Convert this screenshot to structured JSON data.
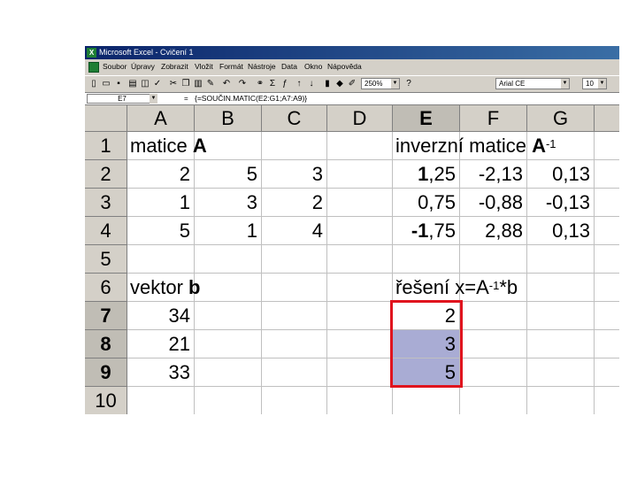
{
  "window": {
    "title": "Microsoft Excel - Cvičení 1"
  },
  "menu": [
    "Soubor",
    "Úpravy",
    "Zobrazit",
    "Vložit",
    "Formát",
    "Nástroje",
    "Data",
    "Okno",
    "Nápověda"
  ],
  "toolbar": {
    "zoom": "250%",
    "font": "Arial CE",
    "font_size": "10"
  },
  "formula_bar": {
    "name_box": "E7",
    "eq": "=",
    "formula": "{=SOUČIN.MATIC(E2:G1;A7:A9)}"
  },
  "columns": [
    "A",
    "B",
    "C",
    "D",
    "E",
    "F",
    "G"
  ],
  "rows": [
    "1",
    "2",
    "3",
    "4",
    "5",
    "6",
    "7",
    "8",
    "9",
    "10"
  ],
  "cells": {
    "A1": "matice ",
    "A1_bold": "A",
    "E1": "inverzní matice ",
    "E1_bold": "A",
    "E1_sup": "-1",
    "A2": "2",
    "B2": "5",
    "C2": "3",
    "A3": "1",
    "B3": "3",
    "C3": "2",
    "A4": "5",
    "B4": "1",
    "C4": "4",
    "E2": ",25",
    "E2_bold": "1",
    "F2": "-2,13",
    "G2": "0,13",
    "E3": "0,75",
    "F3": "-0,88",
    "G3": "-0,13",
    "E4": ",75",
    "E4_bold": "-1",
    "F4": "2,88",
    "G4": "0,13",
    "A6": "vektor ",
    "A6_bold": "b",
    "E6": "řešení x=A",
    "E6_sup": "-1",
    "E6_tail": "*b",
    "A7": "34",
    "A8": "21",
    "A9": "33",
    "E7": "2",
    "E8": "3",
    "E9": "5"
  },
  "colors": {
    "selection_border": "#e0141e",
    "selection_fill": "#a9acd4",
    "chrome": "#d4d0c8"
  }
}
